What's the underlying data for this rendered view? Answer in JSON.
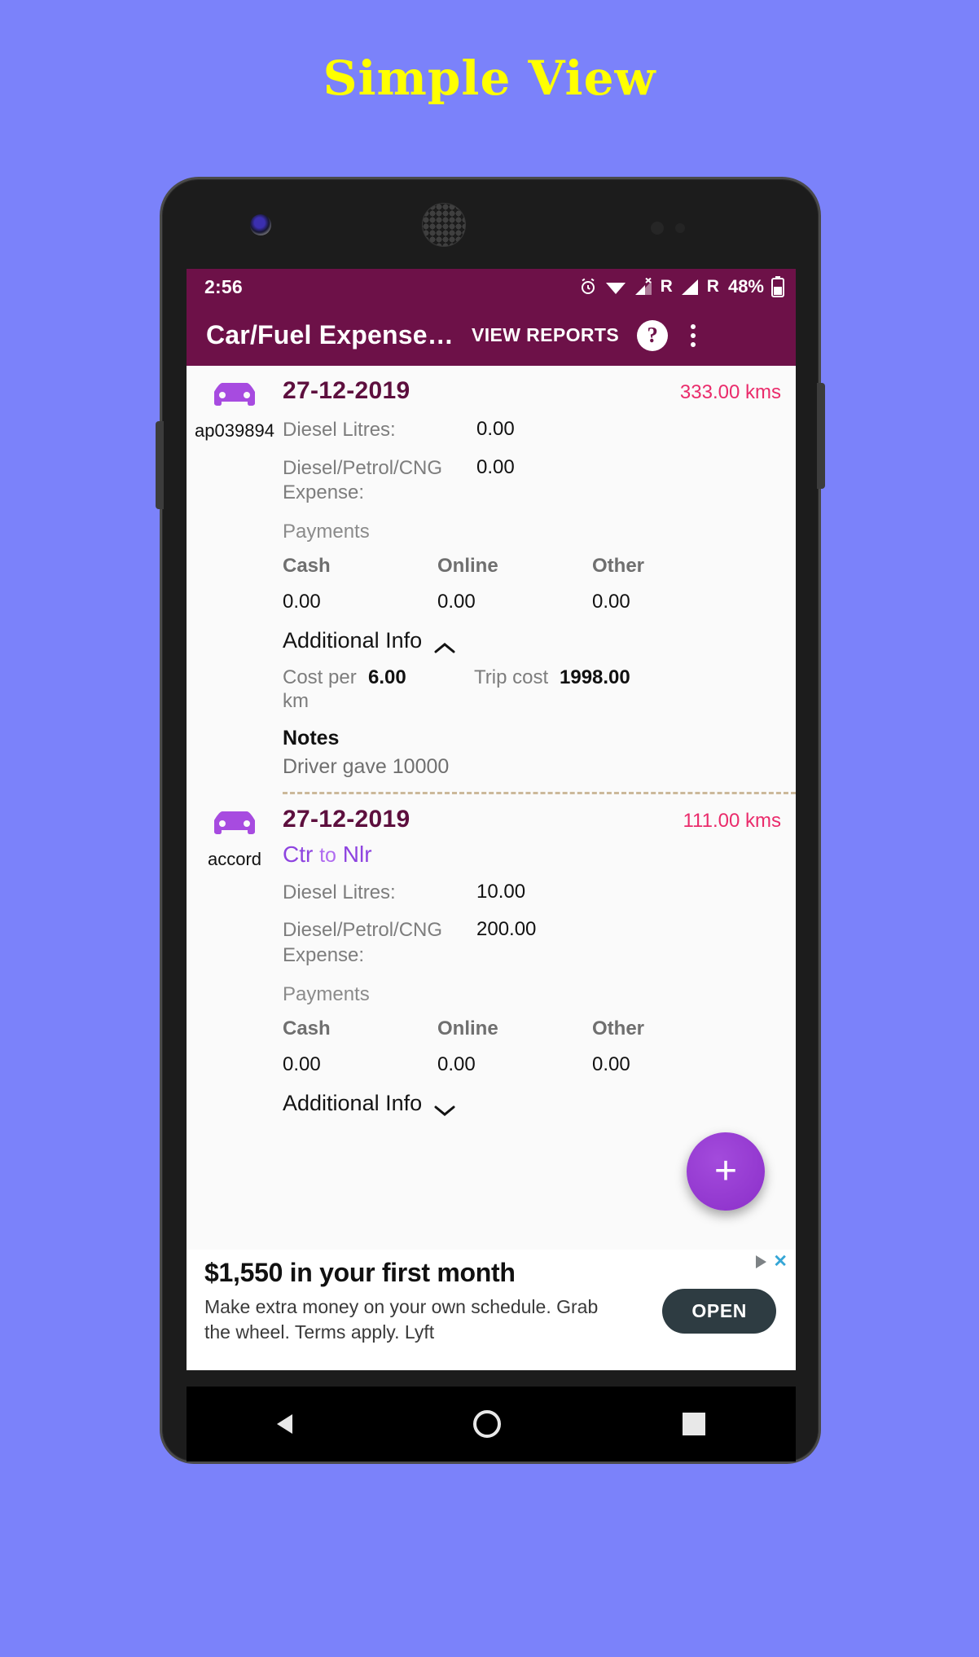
{
  "page": {
    "heading": "Simple View",
    "bg_color": "#7b82fa",
    "heading_color": "#ffff00"
  },
  "status_bar": {
    "time": "2:56",
    "roaming_1": "R",
    "roaming_2": "R",
    "battery_percent": "48%",
    "icons": [
      "alarm-icon",
      "wifi-icon",
      "signal-no-service-icon",
      "signal-icon",
      "battery-icon"
    ]
  },
  "app_bar": {
    "title": "Car/Fuel Expense…",
    "reports_label": "VIEW REPORTS",
    "help_label": "?",
    "menu_label": "⋮",
    "bg_color": "#6d1148"
  },
  "entries": [
    {
      "vehicle_name": "ap039894",
      "date": "27-12-2019",
      "distance": "333.00 kms",
      "route_from": "",
      "route_to": "",
      "litres_label": "Diesel Litres:",
      "litres_value": "0.00",
      "expense_label": "Diesel/Petrol/CNG Expense:",
      "expense_value": "0.00",
      "payments_label": "Payments",
      "payments": [
        {
          "label": "Cash",
          "value": "0.00"
        },
        {
          "label": "Online",
          "value": "0.00"
        },
        {
          "label": "Other",
          "value": "0.00"
        }
      ],
      "additional_info_label": "Additional Info",
      "expanded": true,
      "cost_per_km_label": "Cost per km",
      "cost_per_km_value": "6.00",
      "trip_cost_label": "Trip cost",
      "trip_cost_value": "1998.00",
      "notes_label": "Notes",
      "notes_value": "Driver gave 10000"
    },
    {
      "vehicle_name": "accord",
      "date": "27-12-2019",
      "distance": "111.00 kms",
      "route_from": "Ctr",
      "route_sep": "to",
      "route_to": "Nlr",
      "litres_label": "Diesel Litres:",
      "litres_value": "10.00",
      "expense_label": "Diesel/Petrol/CNG Expense:",
      "expense_value": "200.00",
      "payments_label": "Payments",
      "payments": [
        {
          "label": "Cash",
          "value": "0.00"
        },
        {
          "label": "Online",
          "value": "0.00"
        },
        {
          "label": "Other",
          "value": "0.00"
        }
      ],
      "additional_info_label": "Additional Info",
      "expanded": false
    }
  ],
  "fab": {
    "label": "+",
    "color": "#8b2fc9"
  },
  "ad": {
    "headline": "$1,550 in your first month",
    "body": "Make extra money on your own schedule. Grab the wheel. Terms apply. Lyft",
    "cta": "OPEN",
    "close_label": "✕"
  },
  "nav_bar": {
    "back": "back-icon",
    "home": "home-icon",
    "recents": "recents-icon"
  }
}
